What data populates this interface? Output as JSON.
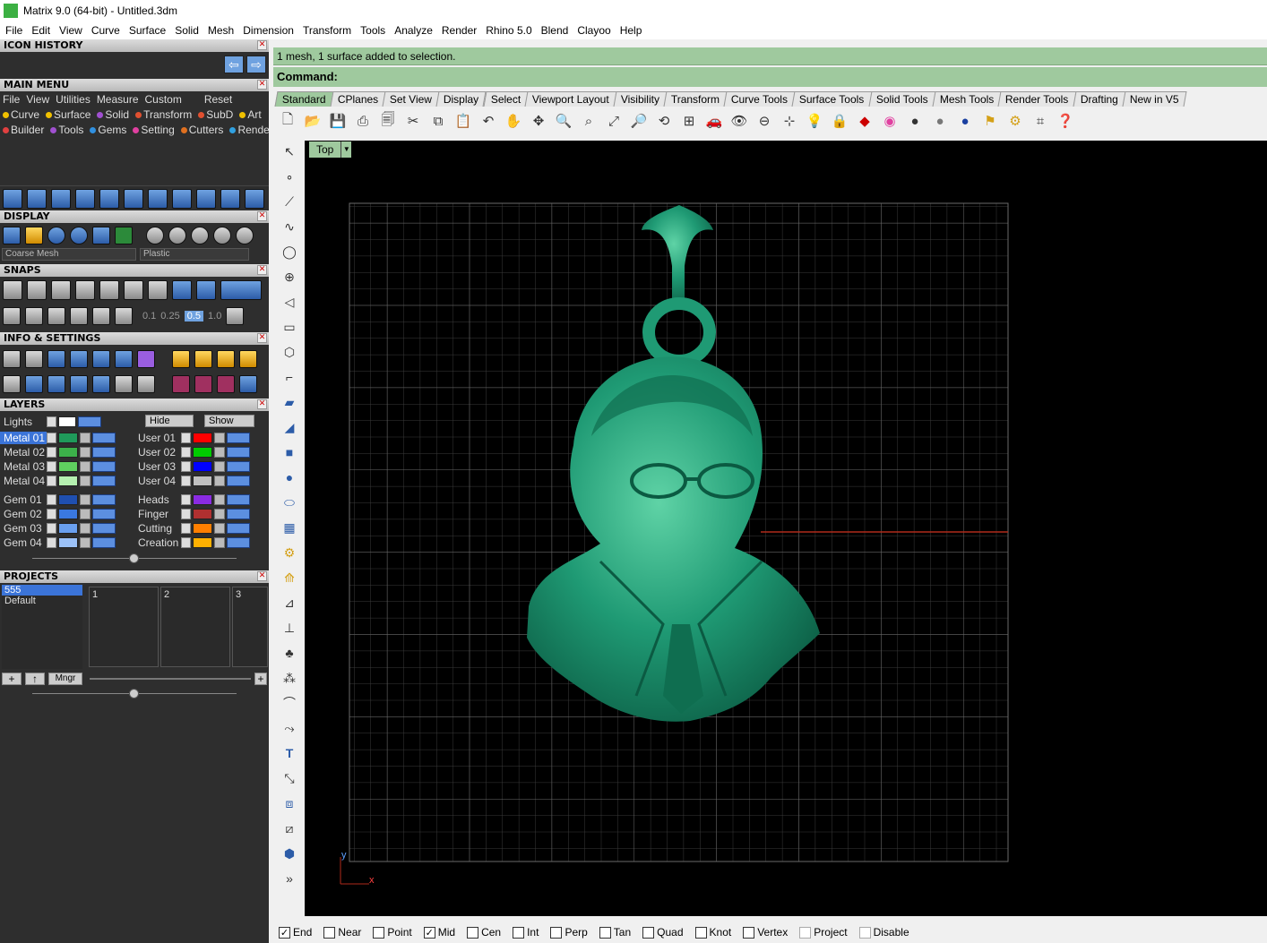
{
  "window": {
    "title": "Matrix 9.0 (64-bit) - Untitled.3dm"
  },
  "menubar": [
    "File",
    "Edit",
    "View",
    "Curve",
    "Surface",
    "Solid",
    "Mesh",
    "Dimension",
    "Transform",
    "Tools",
    "Analyze",
    "Render",
    "Rhino 5.0",
    "Blend",
    "Clayoo",
    "Help"
  ],
  "panels": {
    "icon_history": "ICON HISTORY",
    "main_menu": "MAIN MENU",
    "display": "DISPLAY",
    "snaps": "SNAPS",
    "info_settings": "INFO & SETTINGS",
    "layers": "LAYERS",
    "projects": "PROJECTS"
  },
  "main_menu": {
    "row1": [
      "File",
      "View",
      "Utilities",
      "Measure",
      "Custom",
      "Reset"
    ],
    "row2": [
      {
        "label": "Curve",
        "color": "#f0c000"
      },
      {
        "label": "Surface",
        "color": "#f0c000"
      },
      {
        "label": "Solid",
        "color": "#a050d0"
      },
      {
        "label": "Transform",
        "color": "#e05030"
      },
      {
        "label": "SubD",
        "color": "#e05030"
      },
      {
        "label": "Art",
        "color": "#f0c000"
      }
    ],
    "row3": [
      {
        "label": "Builder",
        "color": "#e04040"
      },
      {
        "label": "Tools",
        "color": "#a050d0"
      },
      {
        "label": "Gems",
        "color": "#3090e0"
      },
      {
        "label": "Setting",
        "color": "#e040a0"
      },
      {
        "label": "Cutters",
        "color": "#e07020"
      },
      {
        "label": "Render",
        "color": "#30a0e0"
      }
    ]
  },
  "display": {
    "mesh_select": "Coarse Mesh",
    "material_select": "Plastic"
  },
  "snaps": {
    "values": [
      "0.1",
      "0.25",
      "0.5",
      "1.0"
    ]
  },
  "layers": {
    "lights": "Lights",
    "hide": "Hide",
    "show": "Show",
    "left": [
      {
        "name": "Metal 01",
        "color": "#1f9a5a"
      },
      {
        "name": "Metal 02",
        "color": "#3cb04a"
      },
      {
        "name": "Metal 03",
        "color": "#5fd05f"
      },
      {
        "name": "Metal 04",
        "color": "#b5f0b0"
      },
      {
        "name": "Gem 01",
        "color": "#1f4fb0"
      },
      {
        "name": "Gem 02",
        "color": "#3a78e0"
      },
      {
        "name": "Gem 03",
        "color": "#6aa0f0"
      },
      {
        "name": "Gem 04",
        "color": "#9cc2f8"
      }
    ],
    "right": [
      {
        "name": "User 01",
        "color": "#ff0000"
      },
      {
        "name": "User 02",
        "color": "#00cc00"
      },
      {
        "name": "User 03",
        "color": "#0000ff"
      },
      {
        "name": "User 04",
        "color": "#c0c0c0"
      },
      {
        "name": "Heads",
        "color": "#8a2be2"
      },
      {
        "name": "Finger",
        "color": "#b03030"
      },
      {
        "name": "Cutting",
        "color": "#ff7f00"
      },
      {
        "name": "Creation",
        "color": "#ffb000"
      }
    ]
  },
  "projects": {
    "items": [
      "555",
      "Default"
    ],
    "slots": [
      "1",
      "2",
      "3"
    ],
    "manager": "Mngr"
  },
  "status": {
    "message": "1 mesh, 1 surface added to selection.",
    "command": "Command:"
  },
  "tabs": [
    "Standard",
    "CPlanes",
    "Set View",
    "Display",
    "Select",
    "Viewport Layout",
    "Visibility",
    "Transform",
    "Curve Tools",
    "Surface Tools",
    "Solid Tools",
    "Mesh Tools",
    "Render Tools",
    "Drafting",
    "New in V5"
  ],
  "viewport": {
    "label": "Top",
    "axis_y": "y",
    "axis_x": "x"
  },
  "osnaps": [
    {
      "label": "End",
      "checked": true
    },
    {
      "label": "Near",
      "checked": false
    },
    {
      "label": "Point",
      "checked": false
    },
    {
      "label": "Mid",
      "checked": true
    },
    {
      "label": "Cen",
      "checked": false
    },
    {
      "label": "Int",
      "checked": false
    },
    {
      "label": "Perp",
      "checked": false
    },
    {
      "label": "Tan",
      "checked": false
    },
    {
      "label": "Quad",
      "checked": false
    },
    {
      "label": "Knot",
      "checked": false
    },
    {
      "label": "Vertex",
      "checked": false
    },
    {
      "label": "Project",
      "checked": false
    },
    {
      "label": "Disable",
      "checked": false
    }
  ]
}
